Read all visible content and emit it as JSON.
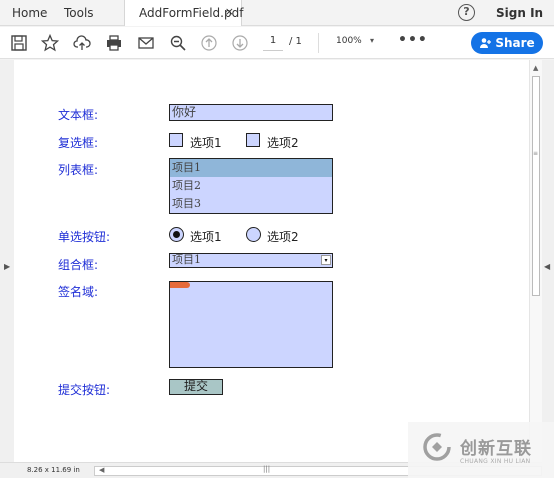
{
  "menubar": {
    "home": "Home",
    "tools": "Tools",
    "tab_label": "AddFormField.pdf",
    "tab_close": "×",
    "help": "?",
    "sign_in": "Sign In"
  },
  "toolbar": {
    "page_current": "1",
    "page_of": "/ 1",
    "zoom": "100%",
    "zoom_caret": "▾",
    "more": "•••",
    "share": "Share"
  },
  "form": {
    "text_field": {
      "label": "文本框:",
      "value": "你好"
    },
    "checkbox": {
      "label": "复选框:",
      "options": [
        "选项1",
        "选项2"
      ]
    },
    "listbox": {
      "label": "列表框:",
      "items": [
        "项目1",
        "项目2",
        "项目3"
      ],
      "selected_index": 0
    },
    "radio": {
      "label": "单选按钮:",
      "options": [
        "选项1",
        "选项2"
      ],
      "checked_index": 0
    },
    "combo": {
      "label": "组合框:",
      "value": "项目1",
      "arrow": "▾"
    },
    "signature": {
      "label": "签名域:"
    },
    "submit": {
      "label": "提交按钮:",
      "button": "提交"
    }
  },
  "statusbar": {
    "page_size": "8.26 x 11.69 in"
  },
  "watermark": {
    "brand": "创新互联",
    "sub": "CHUANG XIN HU LIAN"
  },
  "colors": {
    "accent": "#1473e6",
    "label_blue": "#1f2ed6",
    "field_fill": "#ccd5ff"
  }
}
